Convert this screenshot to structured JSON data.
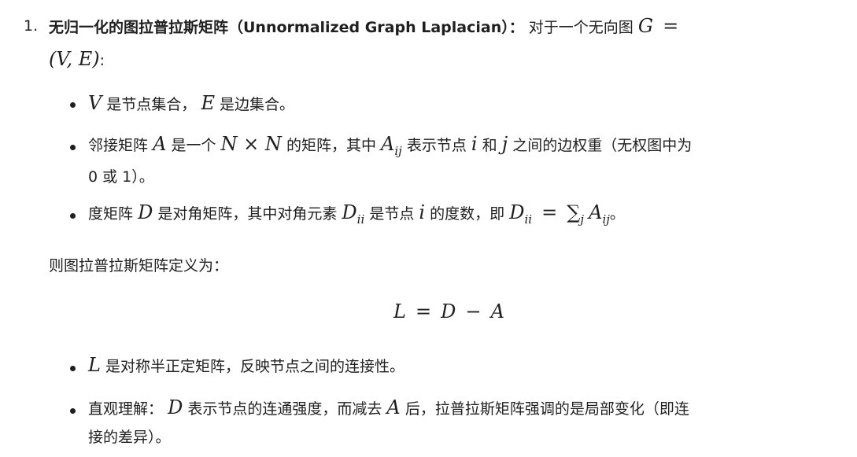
{
  "item": {
    "number": "1.",
    "title_bold": "无归一化的图拉普拉斯矩阵（Unnormalized Graph Laplacian）：",
    "intro_text": "对于一个无向图",
    "graph_def": {
      "g": "G",
      "eq": "=",
      "tuple": "(V, E)",
      "colon": ":"
    }
  },
  "bullets_top": {
    "b1": {
      "v": "V",
      "t1": "是节点集合，",
      "e": "E",
      "t2": "是边集合。"
    },
    "b2": {
      "t1": "邻接矩阵",
      "a": "A",
      "t2": "是一个",
      "nxn": "N × N",
      "t3": "的矩阵，其中",
      "aij_base": "A",
      "aij_sub": "ij",
      "t4": "表示节点",
      "i": "i",
      "t5": "和",
      "j": "j",
      "t6": "之间的边权重（无权图中为",
      "line2": "0 或 1）。"
    },
    "b3": {
      "t1": "度矩阵",
      "d": "D",
      "t2": "是对角矩阵，其中对角元素",
      "dii_base": "D",
      "dii_sub": "ii",
      "t3": "是节点",
      "i": "i",
      "t4": "的度数，即",
      "dii2_base": "D",
      "dii2_sub": "ii",
      "eq": "=",
      "sum": "∑",
      "sum_sub": "j",
      "aij_base": "A",
      "aij_sub": "ij",
      "t5": "。"
    }
  },
  "definition_text": "则图拉普拉斯矩阵定义为：",
  "formula": {
    "l": "L",
    "eq": "=",
    "d": "D",
    "minus": "−",
    "a": "A"
  },
  "bullets_bottom": {
    "b4": {
      "l": "L",
      "t1": "是对称半正定矩阵，反映节点之间的连接性。"
    },
    "b5": {
      "t1": "直观理解：",
      "d": "D",
      "t2": "表示节点的连通强度，而减去",
      "a": "A",
      "t3": "后，拉普拉斯矩阵强调的是局部变化（即连",
      "line2": "接的差异）。"
    }
  }
}
